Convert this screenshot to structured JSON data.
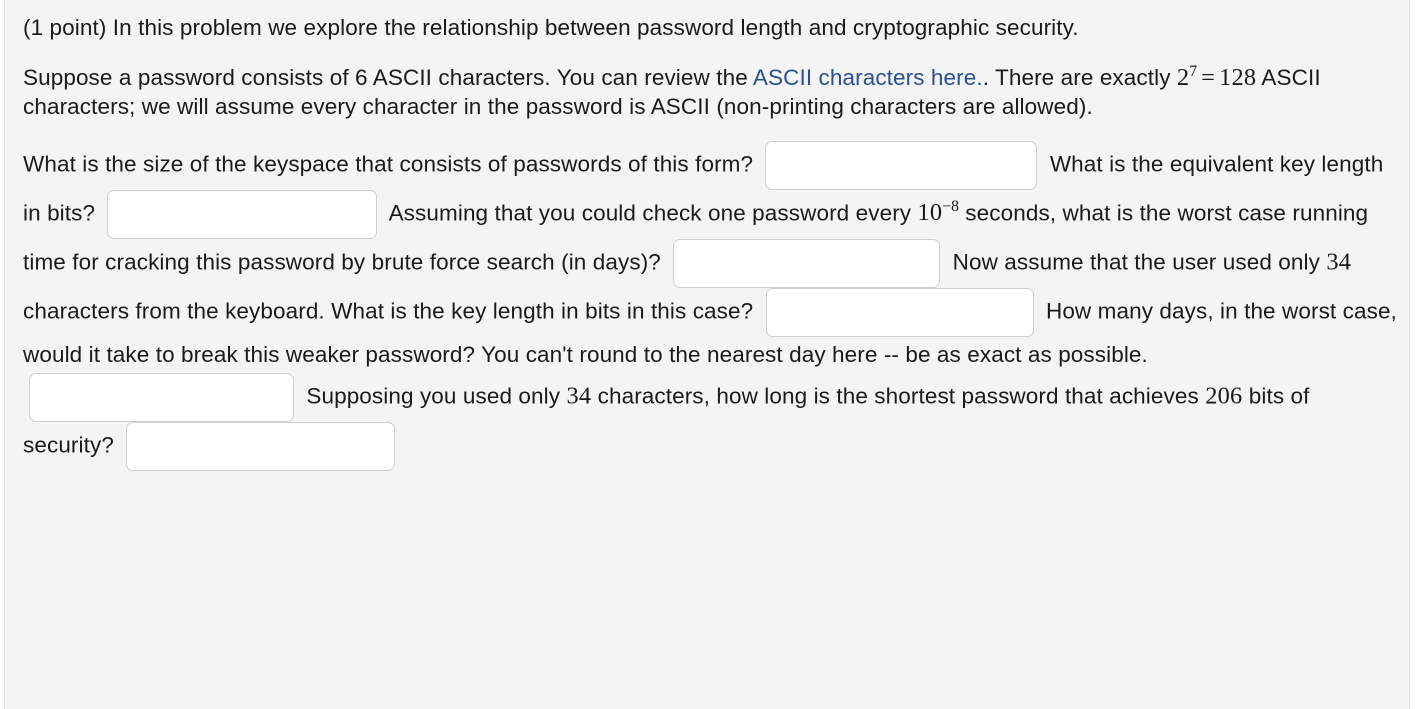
{
  "problem": {
    "intro": "(1 point) In this problem we explore the relationship between password length and cryptographic security.",
    "setup": {
      "before_link": "Suppose a password consists of 6 ASCII characters. You can review the ",
      "link_text": "ASCII characters here.",
      "after_link": ". There are exactly ",
      "math_base": "2",
      "math_exp": "7",
      "math_eq": "=",
      "math_value": "128",
      "after_math": " ASCII characters; we will assume every character in the password is ASCII (non-printing characters are allowed)."
    },
    "questions": {
      "q1": "What is the size of the keyspace that consists of passwords of this form?",
      "q2": "What is the equivalent key length in bits?",
      "q3_before_math": "Assuming that you could check one password every ",
      "q3_math_base": "10",
      "q3_math_exp": "−8",
      "q3_after_math": " seconds, what is the worst case running time for cracking this password by brute force search (in days)?",
      "q4_before_num": "Now assume that the user used only ",
      "q4_num": "34",
      "q4_after_num": " characters from the keyboard. What is the key length in bits in this case?",
      "q5": "How many days, in the worst case, would it take to break this weaker password? You can't round to the nearest day here -- be as exact as possible.",
      "q6_before_num": "Supposing you used only ",
      "q6_num": "34",
      "q6_mid": " characters, how long is the shortest password that achieves ",
      "q6_num2": "206",
      "q6_after_num2": " bits of security?"
    },
    "answers": {
      "keyspace_size": "",
      "key_length_bits": "",
      "worst_case_days": "",
      "weaker_key_length_bits": "",
      "weaker_days": "",
      "shortest_password_length": "",
      "placeholder": ""
    }
  },
  "colors": {
    "panel_background": "#f4f4f4",
    "page_background": "#ffffff",
    "text": "#1a1a1a",
    "link": "#2b4f91",
    "input_border": "#cfcfcf",
    "input_background": "#ffffff"
  }
}
